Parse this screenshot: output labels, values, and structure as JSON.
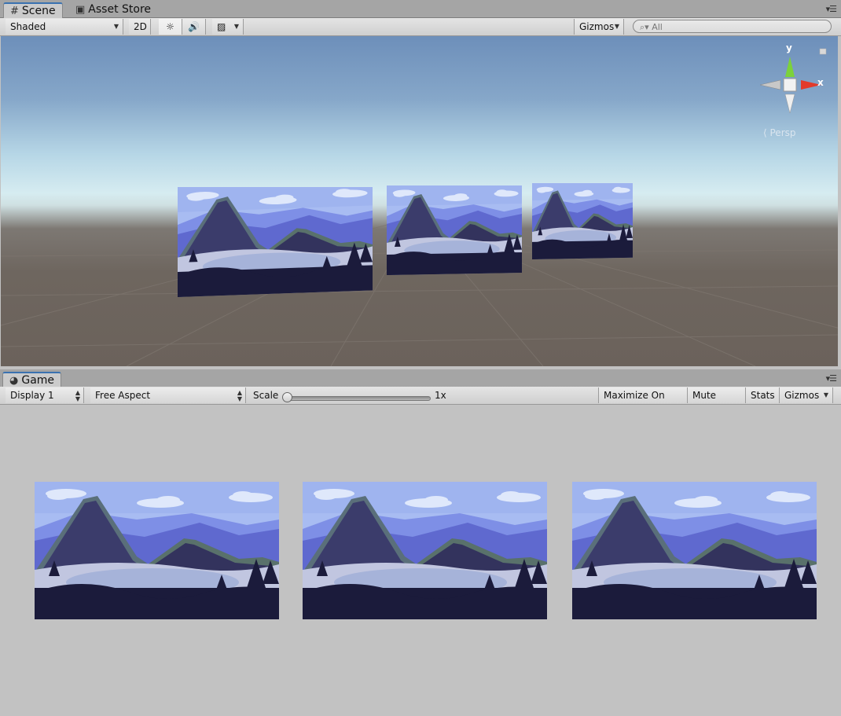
{
  "scene_tabs": {
    "scene": "Scene",
    "asset_store": "Asset Store"
  },
  "scene_toolbar": {
    "shading_mode": "Shaded",
    "mode_2d": "2D",
    "gizmos": "Gizmos",
    "search_placeholder": "All"
  },
  "scene_gizmo": {
    "y_label": "y",
    "x_label": "x",
    "projection": "Persp"
  },
  "game_tabs": {
    "game": "Game"
  },
  "game_toolbar": {
    "display": "Display 1",
    "aspect": "Free Aspect",
    "scale_label": "Scale",
    "scale_value": "1x",
    "maximize": "Maximize On Play",
    "mute": "Mute Audio",
    "stats": "Stats",
    "gizmos": "Gizmos"
  },
  "colors": {
    "active_tab_accent": "#3a72b0",
    "gizmo_x": "#e23a2a",
    "gizmo_y": "#7cd23a"
  }
}
